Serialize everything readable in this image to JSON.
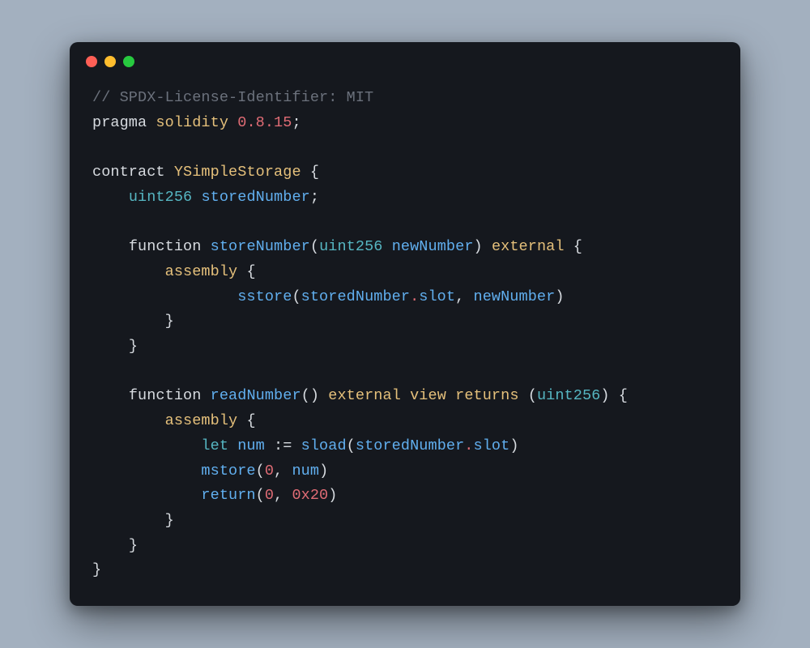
{
  "window": {
    "traffic_lights": {
      "close_color": "#ff5f56",
      "minimize_color": "#ffbd2e",
      "zoom_color": "#27c93f"
    }
  },
  "code": {
    "license_comment": "// SPDX-License-Identifier: MIT",
    "pragma_kw": "pragma",
    "solidity_kw": "solidity",
    "version": "0.8.15",
    "contract_kw": "contract",
    "contract_name": "YSimpleStorage",
    "state_type": "uint256",
    "state_var": "storedNumber",
    "function_kw": "function",
    "store_fn": "storeNumber",
    "store_param_type": "uint256",
    "store_param_name": "newNumber",
    "external_kw": "external",
    "assembly_kw": "assembly",
    "sstore_fn": "sstore",
    "slot_owner": "storedNumber",
    "slot_prop": "slot",
    "read_fn": "readNumber",
    "view_kw": "view",
    "returns_kw": "returns",
    "returns_type": "uint256",
    "let_kw": "let",
    "num_var": "num",
    "assign_op": ":=",
    "sload_fn": "sload",
    "mstore_fn": "mstore",
    "return_fn": "return",
    "zero_lit": "0",
    "hex20_lit": "0x20",
    "comma_sp": ", ",
    "dot": ".",
    "semi": ";",
    "lparen": "(",
    "rparen": ")",
    "lbrace": "{",
    "rbrace": "}",
    "sp": " ",
    "indent1": "    ",
    "indent2": "        ",
    "indent3": "            ",
    "indent4": "                "
  }
}
